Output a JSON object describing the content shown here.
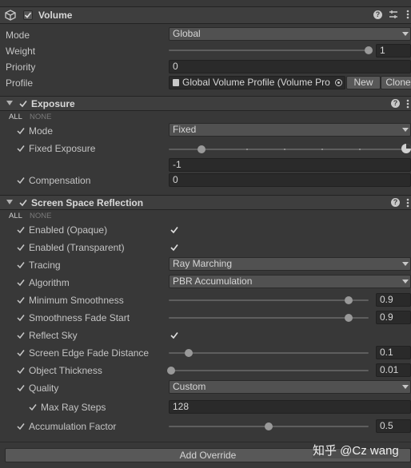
{
  "volume": {
    "title": "Volume",
    "enabled": true,
    "mode": {
      "label": "Mode",
      "value": "Global"
    },
    "weight": {
      "label": "Weight",
      "value": "1",
      "fraction": 1
    },
    "priority": {
      "label": "Priority",
      "value": "0"
    },
    "profile": {
      "label": "Profile",
      "value": "Global Volume Profile (Volume Pro",
      "new_label": "New",
      "clone_label": "Clone"
    }
  },
  "exposure": {
    "title": "Exposure",
    "all_label": "ALL",
    "none_label": "NONE",
    "mode": {
      "label": "Mode",
      "value": "Fixed"
    },
    "fixed_exposure": {
      "label": "Fixed Exposure",
      "value": "-1",
      "fraction": 0.14
    },
    "compensation": {
      "label": "Compensation",
      "value": "0"
    }
  },
  "ssr": {
    "title": "Screen Space Reflection",
    "all_label": "ALL",
    "none_label": "NONE",
    "enabled_opaque": {
      "label": "Enabled (Opaque)",
      "checked": true
    },
    "enabled_transparent": {
      "label": "Enabled (Transparent)",
      "checked": true
    },
    "tracing": {
      "label": "Tracing",
      "value": "Ray Marching"
    },
    "algorithm": {
      "label": "Algorithm",
      "value": "PBR Accumulation"
    },
    "min_smoothness": {
      "label": "Minimum Smoothness",
      "value": "0.9",
      "fraction": 0.9
    },
    "smoothness_fade": {
      "label": "Smoothness Fade Start",
      "value": "0.9",
      "fraction": 0.9
    },
    "reflect_sky": {
      "label": "Reflect Sky",
      "checked": true
    },
    "edge_fade": {
      "label": "Screen Edge Fade Distance",
      "value": "0.1",
      "fraction": 0.1
    },
    "thickness": {
      "label": "Object Thickness",
      "value": "0.01",
      "fraction": 0.01
    },
    "quality": {
      "label": "Quality",
      "value": "Custom"
    },
    "max_ray_steps": {
      "label": "Max Ray Steps",
      "value": "128"
    },
    "accumulation": {
      "label": "Accumulation Factor",
      "value": "0.5",
      "fraction": 0.5
    }
  },
  "add_override_label": "Add Override",
  "watermark": "知乎 @Cz wang"
}
